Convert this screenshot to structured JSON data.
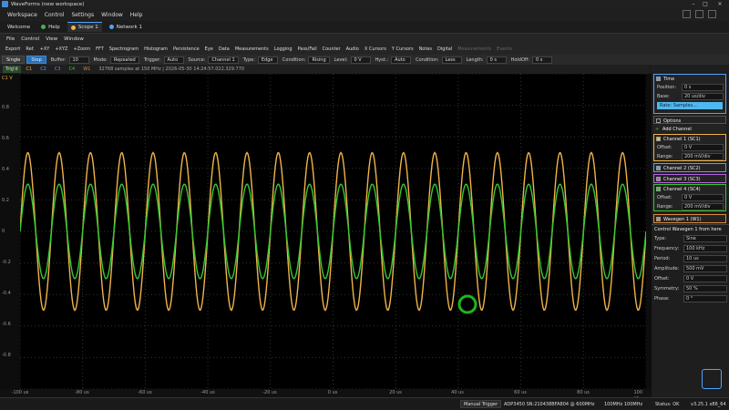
{
  "window": {
    "title": "WaveForms (new workspace)"
  },
  "menu": [
    "Workspace",
    "Control",
    "Settings",
    "Window",
    "Help"
  ],
  "tabs": {
    "welcome": "Welcome",
    "help": "Help",
    "scope": "Scope 1",
    "network": "Network 1"
  },
  "subbar": [
    "File",
    "Control",
    "View",
    "Window"
  ],
  "tools": [
    "Export",
    "Ref.",
    "+XY",
    "+XYZ",
    "+Zoom",
    "FFT",
    "Spectrogram",
    "Histogram",
    "Persistence",
    "Eye",
    "Data",
    "Measurements",
    "Logging",
    "Pass/Fail",
    "Counter",
    "Audio",
    "X Cursors",
    "Y Cursors",
    "Notes",
    "Digital"
  ],
  "tools_dim": [
    "Measurements",
    "Events"
  ],
  "control": {
    "single": "Single",
    "stop": "Stop",
    "buffer_label": "Buffer:",
    "buffer_value": "10",
    "mode_label": "Mode:",
    "mode_value": "Repeated",
    "trigger_label": "Trigger:",
    "trigger_value": "Auto",
    "source_label": "Source:",
    "source_value": "Channel 1",
    "type_label": "Type:",
    "type_value": "Edge",
    "condition_label": "Condition:",
    "condition_value": "Rising",
    "level_label": "Level:",
    "level_value": "0 V",
    "hyst_label": "Hyst.:",
    "hyst_value": "Auto",
    "condition2_label": "Condition:",
    "condition2_value": "Less",
    "length_label": "Length:",
    "length_value": "0 s",
    "holdoff_label": "HoldOff:",
    "holdoff_value": "0 s"
  },
  "chanbar": {
    "trig": "Trig'd",
    "c1": "C1",
    "c2": "C2",
    "c3": "C3",
    "c4": "C4",
    "w1": "W1",
    "info": "32768 samples at 150 MHz | 2026-05-30 14:24:57.022.329.770"
  },
  "y_ticks": [
    "0.8",
    "0.6",
    "0.4",
    "0.2",
    "0",
    "-0.2",
    "-0.4",
    "-0.6",
    "-0.8"
  ],
  "y_unit": "C1 V",
  "x_ticks": [
    "-100 us",
    "-80 us",
    "-60 us",
    "-40 us",
    "-20 us",
    "0 us",
    "20 us",
    "40 us",
    "60 us",
    "80 us",
    "100 us"
  ],
  "panel": {
    "time_title": "Time",
    "position_label": "Position:",
    "position_value": "0 s",
    "base_label": "Base:",
    "base_value": "20 us/div",
    "rate_button": "Rate: Samples...",
    "options": "Options",
    "add_channel": "Add Channel",
    "ch1": "Channel 1 (SC1)",
    "offset_label": "Offset:",
    "offset_value": "0 V",
    "range_label": "Range:",
    "range_value": "200 mV/div",
    "ch2": "Channel 2 (SC2)",
    "ch3": "Channel 3 (SC3)",
    "ch4": "Channel 4 (SC4)",
    "ch4_offset": "0 V",
    "ch4_range": "200 mV/div",
    "wavegen": "Wavegen 1 (W1)"
  },
  "wavegen": {
    "title": "Control Wavegen 1 from here",
    "rows": [
      {
        "label": "Type:",
        "value": "Sine"
      },
      {
        "label": "Frequency:",
        "value": "100 kHz"
      },
      {
        "label": "Period:",
        "value": "10 us"
      },
      {
        "label": "Amplitude:",
        "value": "500 mV"
      },
      {
        "label": "Offset:",
        "value": "0 V"
      },
      {
        "label": "Symmetry:",
        "value": "50 %"
      },
      {
        "label": "Phase:",
        "value": "0 °"
      }
    ]
  },
  "status": {
    "manual_trigger": "Manual Trigger",
    "device": "ADP3450 SN:210438BFA804 @ 600MHz",
    "clock": "100MHz 100MHz",
    "status": "Status: OK",
    "version": "v3.25.1 x86_64"
  },
  "colors": {
    "ch1": "#f0b34a",
    "ch4": "#35c832",
    "accent": "#4fa3ff",
    "grid": "#2a3a2a"
  },
  "signals": [
    {
      "name": "Channel 1",
      "amplitude_v": 0.5,
      "frequency_khz": 100,
      "color": "#f0b34a"
    },
    {
      "name": "Channel 4",
      "amplitude_v": 0.3,
      "frequency_khz": 100,
      "color": "#35c832"
    }
  ]
}
